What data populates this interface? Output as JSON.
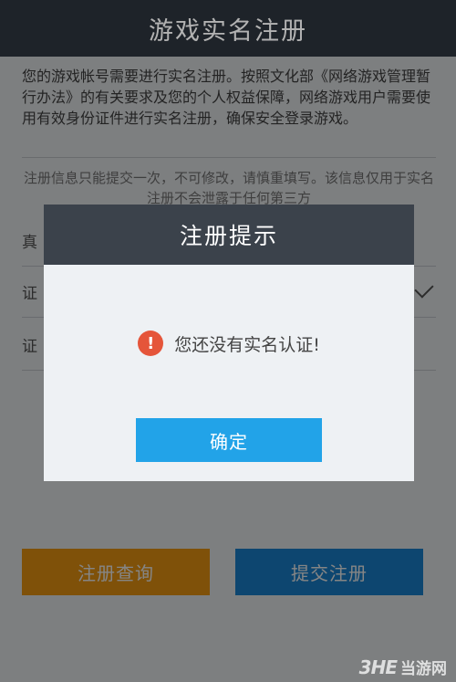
{
  "header": {
    "title": "游戏实名注册"
  },
  "intro": {
    "text": "您的游戏帐号需要进行实名注册。按照文化部《网络游戏管理暂行办法》的有关要求及您的个人权益保障，网络游戏用户需要使用有效身份证件进行实名注册，确保安全登录游戏。"
  },
  "notice": {
    "text": "注册信息只能提交一次，不可修改，请慎重填写。该信息仅用于实名注册不会泄露于任何第三方"
  },
  "form": {
    "rows": [
      {
        "label": "真",
        "placeholder": ""
      },
      {
        "label": "证",
        "placeholder": ""
      },
      {
        "label": "证",
        "placeholder": ""
      }
    ]
  },
  "buttons": {
    "query_label": "注册查询",
    "submit_label": "提交注册"
  },
  "dialog": {
    "title": "注册提示",
    "icon": "!",
    "message": "您还没有实名认证!",
    "ok_label": "确定"
  },
  "watermark": {
    "logo": "3HE",
    "text": "当游网"
  },
  "colors": {
    "header_bg": "#2c333b",
    "query_btn": "#f39c12",
    "submit_btn": "#1a86d6",
    "ok_btn": "#22a3e8",
    "warn_icon": "#e5553a"
  }
}
